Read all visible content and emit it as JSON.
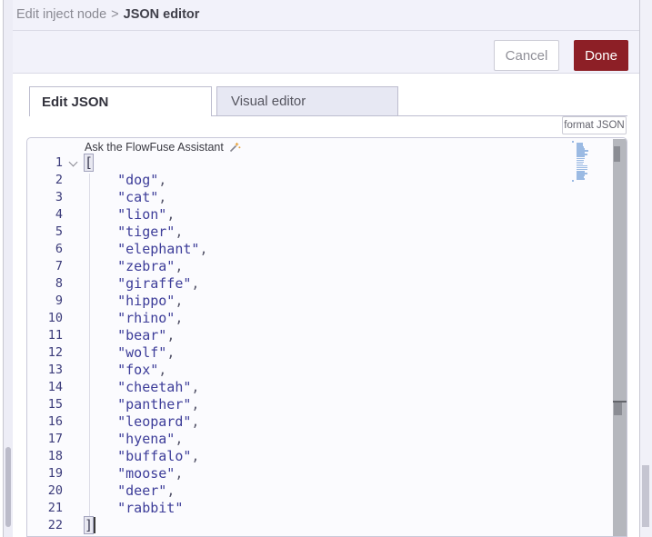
{
  "breadcrumb": {
    "parent": "Edit inject node",
    "separator": ">",
    "current": "JSON editor"
  },
  "buttons": {
    "cancel": "Cancel",
    "done": "Done",
    "format": "format JSON"
  },
  "tabs": [
    {
      "id": "edit-json",
      "label": "Edit JSON",
      "active": true
    },
    {
      "id": "visual-editor",
      "label": "Visual editor",
      "active": false
    }
  ],
  "assistant": {
    "label": "Ask the FlowFuse Assistant",
    "icon": "magic-wand-icon"
  },
  "editor": {
    "language": "json",
    "line_count": 22,
    "cursor_line": 22,
    "folded": false,
    "lines": [
      "[",
      "    \"dog\",",
      "    \"cat\",",
      "    \"lion\",",
      "    \"tiger\",",
      "    \"elephant\",",
      "    \"zebra\",",
      "    \"giraffe\",",
      "    \"hippo\",",
      "    \"rhino\",",
      "    \"bear\",",
      "    \"wolf\",",
      "    \"fox\",",
      "    \"cheetah\",",
      "    \"panther\",",
      "    \"leopard\",",
      "    \"hyena\",",
      "    \"buffalo\",",
      "    \"moose\",",
      "    \"deer\",",
      "    \"rabbit\"",
      "]"
    ],
    "values": [
      "dog",
      "cat",
      "lion",
      "tiger",
      "elephant",
      "zebra",
      "giraffe",
      "hippo",
      "rhino",
      "bear",
      "wolf",
      "fox",
      "cheetah",
      "panther",
      "leopard",
      "hyena",
      "buffalo",
      "moose",
      "deer",
      "rabbit"
    ]
  },
  "colors": {
    "accent_done": "#8D1F26",
    "header_bg": "#f2f2fa",
    "tab_inactive_bg": "#e7e8f3",
    "string": "#3d3d99",
    "line_number": "#3b3b7a",
    "minimap_mark": "#8aaede"
  }
}
